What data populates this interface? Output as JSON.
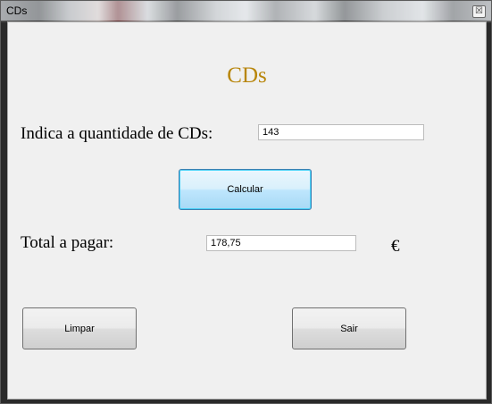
{
  "window": {
    "title": "CDs",
    "close_glyph": "☒"
  },
  "form": {
    "heading": "CDs",
    "quantity_label": "Indica a quantidade de CDs:",
    "quantity_value": "143",
    "calc_button": "Calcular",
    "total_label": "Total a pagar:",
    "total_value": "178,75",
    "currency_symbol": "€",
    "clear_button": "Limpar",
    "exit_button": "Sair"
  },
  "colors": {
    "heading": "#b8860b",
    "client_bg": "#f0f0f0",
    "focus_border": "#3c7fb1"
  }
}
